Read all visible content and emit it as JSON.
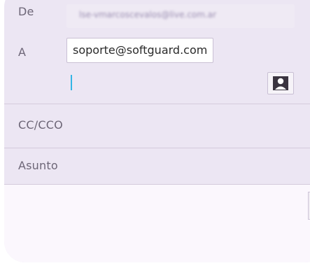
{
  "compose": {
    "from": {
      "label": "De",
      "value": "lse-vmarcoscevalos@live.com.ar"
    },
    "to": {
      "label": "A",
      "chip": "soporte@softguard.com"
    },
    "cc": {
      "label": "CC/CCO"
    },
    "subject": {
      "label": "Asunto"
    }
  },
  "icons": {
    "contact_picker": "person-contact-icon"
  },
  "colors": {
    "background": "#ece6f3",
    "body_background": "#fbf7fd",
    "caret": "#33b5e5",
    "label_text": "#6d6677"
  }
}
